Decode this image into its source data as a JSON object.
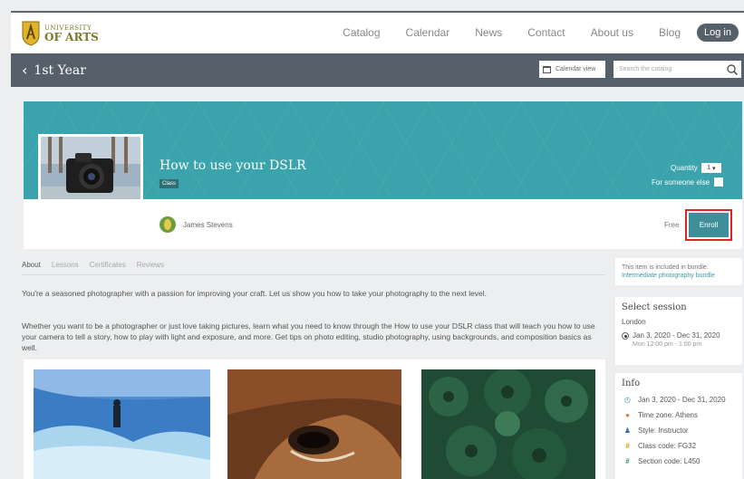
{
  "header": {
    "logo": {
      "line1": "UNIVERSITY",
      "line2": "OF ARTS"
    },
    "nav": [
      "Catalog",
      "Calendar",
      "News",
      "Contact",
      "About us",
      "Blog"
    ],
    "login_label": "Log in"
  },
  "subbar": {
    "back_label": "1st Year",
    "calendar_view_label": "Calendar view",
    "search_placeholder": "Search the catalog"
  },
  "course": {
    "title": "How to use your DSLR",
    "badge": "Class",
    "quantity_label": "Quantity",
    "quantity_value": "1",
    "someone_else_label": "For someone else",
    "author": "James Stevens",
    "price": "Free",
    "enroll_label": "Enroll"
  },
  "tabs": [
    "About",
    "Lessons",
    "Certificates",
    "Reviews"
  ],
  "about": {
    "p1": "You're a seasoned photographer with a passion for improving your craft. Let us show you how to take your photography to the next level.",
    "p2": "Whether you want to be a photographer or just love taking pictures, learn what you need to know through the How to use your DSLR class that will teach you how to use your camera to tell a story, how to play with light and exposure, and more. Get tips on photo editing, studio photography, using backgrounds, and composition basics as well."
  },
  "sidebar": {
    "bundle_text": "This item is included in bundle:",
    "bundle_link": "Intermediate photography bundle",
    "session": {
      "title": "Select session",
      "city": "London",
      "date": "Jan 3, 2020 - Dec 31, 2020",
      "time": "Mon 12:00 pm - 1:00 pm"
    },
    "info": {
      "title": "Info",
      "rows": [
        "Jan 3, 2020 - Dec 31, 2020",
        "Time zone: Athens",
        "Style: Instructor",
        "Class code: FG32",
        "Section code: L450"
      ]
    }
  },
  "colors": {
    "dark_bar": "#56606a",
    "teal": "#3aa3ab",
    "enroll": "#3f8f9a",
    "highlight": "#e02424"
  }
}
